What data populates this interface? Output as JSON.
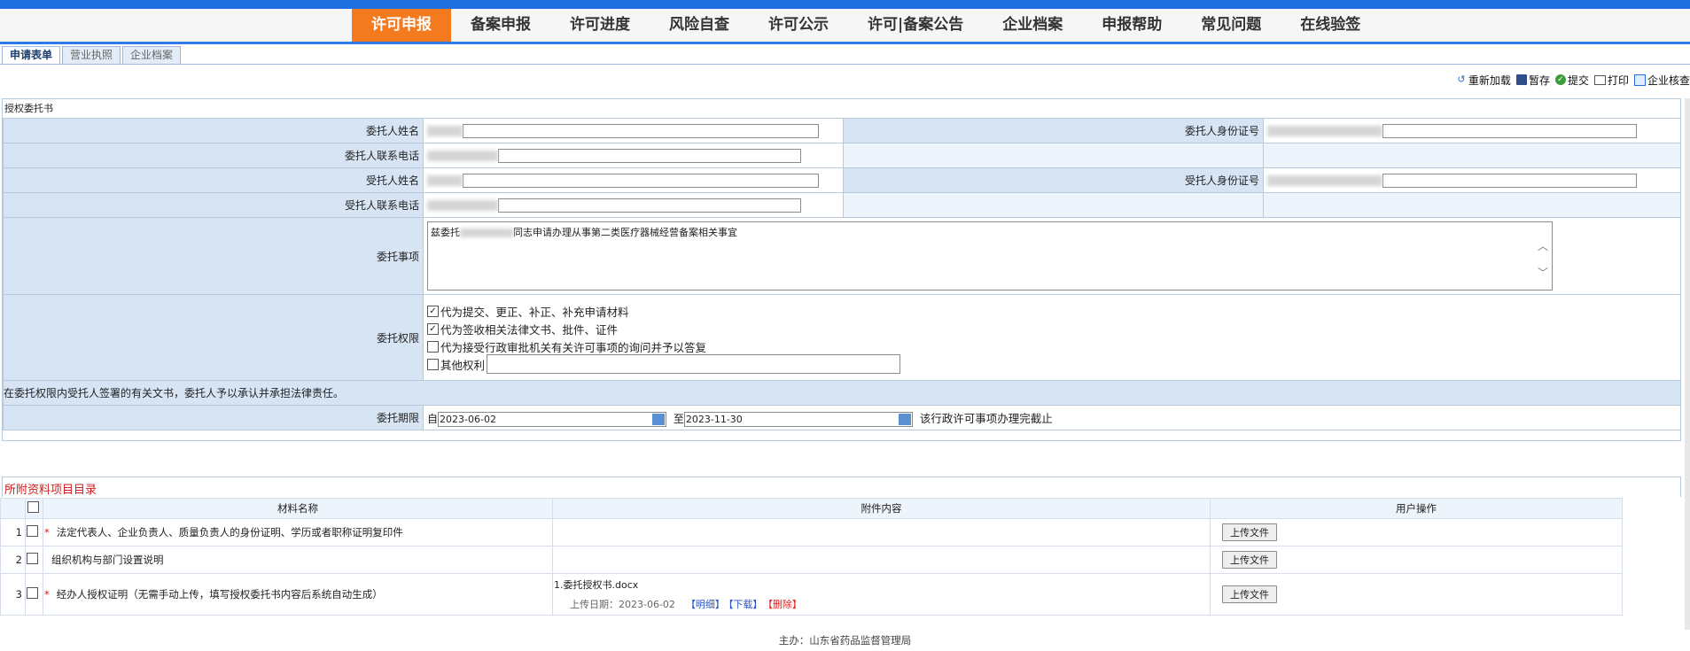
{
  "nav": [
    {
      "label": "许可申报",
      "active": true
    },
    {
      "label": "备案申报"
    },
    {
      "label": "许可进度"
    },
    {
      "label": "风险自查"
    },
    {
      "label": "许可公示"
    },
    {
      "label": "许可|备案公告"
    },
    {
      "label": "企业档案"
    },
    {
      "label": "申报帮助"
    },
    {
      "label": "常见问题"
    },
    {
      "label": "在线验签"
    }
  ],
  "subtabs": [
    "申请表单",
    "营业执照",
    "企业档案"
  ],
  "toolbar": {
    "reload": "重新加载",
    "save": "暂存",
    "submit": "提交",
    "print": "打印",
    "check": "企业核查"
  },
  "form": {
    "title": "授权委托书",
    "principal_name": "委托人姓名",
    "principal_id": "委托人身份证号",
    "principal_phone": "委托人联系电话",
    "agent_name": "受托人姓名",
    "agent_id": "受托人身份证号",
    "agent_phone": "受托人联系电话",
    "matter_label": "委托事项",
    "matter_prefix": "兹委托",
    "matter_suffix": "同志申请办理从事第二类医疗器械经营备案相关事宜",
    "scroll_up": "︿",
    "scroll_down": "﹀",
    "perm_label": "委托权限",
    "perms": [
      {
        "text": "代为提交、更正、补正、补充申请材料",
        "checked": true
      },
      {
        "text": "代为签收相关法律文书、批件、证件",
        "checked": true
      },
      {
        "text": "代为接受行政审批机关有关许可事项的询问并予以答复",
        "checked": false
      },
      {
        "text": "其他权利",
        "checked": false
      }
    ],
    "check_mark": "✓",
    "note": "在委托权限内受托人签署的有关文书，委托人予以承认并承担法律责任。",
    "period_label": "委托期限",
    "from_label": "自",
    "from_date": "2023-06-02",
    "to_label": "至",
    "to_date": "2023-11-30",
    "period_suffix": "该行政许可事项办理完截止"
  },
  "materials": {
    "title": "所附资料项目目录",
    "headers": {
      "name": "材料名称",
      "attach": "附件内容",
      "op": "用户操作"
    },
    "star": "*",
    "rows": [
      {
        "num": "1",
        "name": "法定代表人、企业负责人、质量负责人的身份证明、学历或者职称证明复印件",
        "required": true
      },
      {
        "num": "2",
        "name": "组织机构与部门设置说明",
        "required": false
      },
      {
        "num": "3",
        "name": "经办人授权证明（无需手动上传，填写授权委托书内容后系统自动生成）",
        "required": true
      }
    ],
    "upload_label": "上传文件",
    "attachment": {
      "file": "1.委托授权书.docx",
      "date": "上传日期：2023-06-02",
      "detail": "【明细】",
      "download": "【下载】",
      "delete": "【删除】"
    }
  },
  "footer": "主办：山东省药品监督管理局",
  "icons": {
    "reload": "reload-icon",
    "save": "save-icon",
    "submit": "submit-icon",
    "print": "print-icon",
    "check": "check-icon",
    "calendar": "calendar-icon"
  },
  "colors": {
    "top": "#1f6fe0",
    "active_nav": "#f47a20",
    "label_bg": "#d6e4f4",
    "red": "#d01c1c"
  }
}
